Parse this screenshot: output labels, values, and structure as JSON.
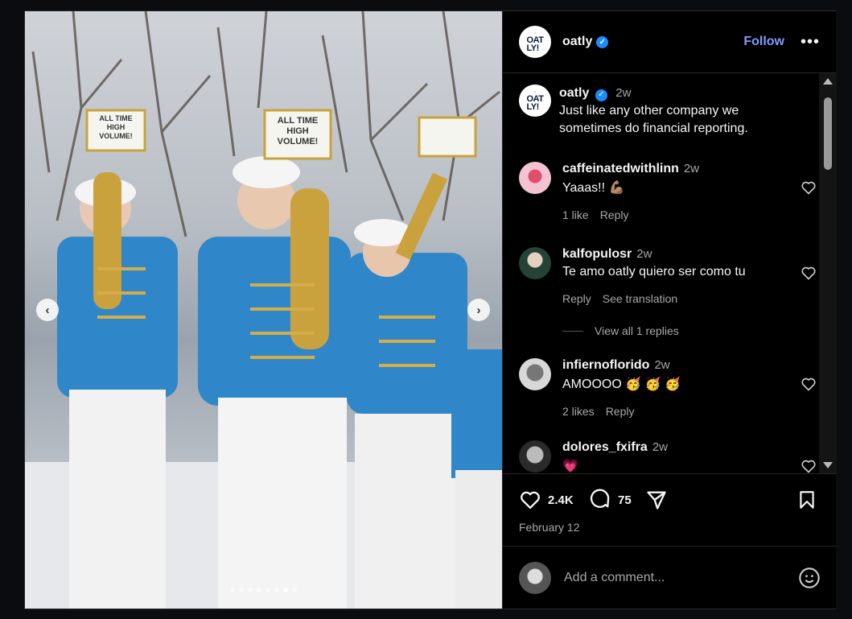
{
  "post": {
    "username": "oatly",
    "follow_label": "Follow",
    "more_label": "•••",
    "logo_text": "OAT\nLY!",
    "date": "February 12",
    "likes": "2.4K",
    "comments_count": "75",
    "caption": {
      "username": "oatly",
      "time": "2w",
      "text": "Just like any other company we sometimes do financial reporting."
    },
    "image_signs": [
      "ALL TIME HIGH VOLUME!",
      "ALL TIME HIGH VOLUME!"
    ]
  },
  "comments": [
    {
      "username": "caffeinatedwithlinn",
      "time": "2w",
      "text": "Yaaas!! 💪🏽",
      "likes": "1 like",
      "reply": "Reply"
    },
    {
      "username": "kalfopulosr",
      "time": "2w",
      "text": "Te amo oatly quiero ser como tu",
      "reply": "Reply",
      "translate": "See translation"
    },
    {
      "username": "infiernoflorido",
      "time": "2w",
      "text": "AMOOOO 🥳 🥳 🥳",
      "likes": "2 likes",
      "reply": "Reply"
    },
    {
      "username": "dolores_fxifra",
      "time": "2w",
      "text": "💗"
    }
  ],
  "view_replies": "View all 1 replies",
  "add_comment_placeholder": "Add a comment...",
  "carousel": {
    "count": 8,
    "active": 6
  },
  "colors": {
    "accent": "#7f9bff",
    "verified": "#1a8cff",
    "uniform_blue": "#2f86c8"
  }
}
